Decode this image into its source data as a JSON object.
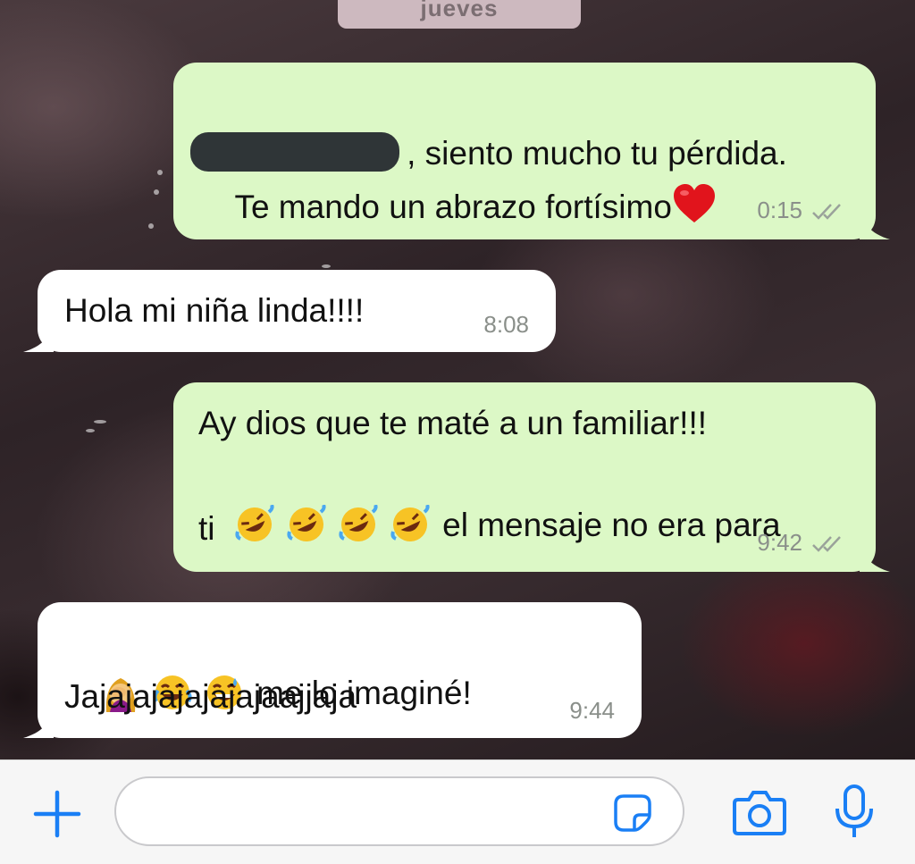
{
  "chat": {
    "date_chip": "jueves",
    "messages": [
      {
        "direction": "outgoing",
        "line1_after_redaction": ", siento mucho tu pérdida.",
        "line2": "Te mando un abrazo fortísimo",
        "time": "0:15",
        "read_receipt": "double-check-icon"
      },
      {
        "direction": "incoming",
        "text": "Hola mi niña linda!!!!",
        "time": "8:08"
      },
      {
        "direction": "outgoing",
        "line1": "Ay dios que te maté a un familiar!!!",
        "line2_text": "el mensaje no era para",
        "line3": "ti",
        "time": "9:42",
        "read_receipt": "double-check-icon"
      },
      {
        "direction": "incoming",
        "line1_text": "me lo imaginé!",
        "line2": "Jajajajajajajajaajjaja",
        "time": "9:44"
      }
    ]
  },
  "composer": {
    "placeholder": "",
    "icons": [
      "plus-icon",
      "sticker-icon",
      "camera-icon",
      "microphone-icon"
    ]
  },
  "colors": {
    "outgoing_bubble": "#dcf8c6",
    "incoming_bubble": "#ffffff",
    "accent_blue": "#1a7ff5"
  }
}
